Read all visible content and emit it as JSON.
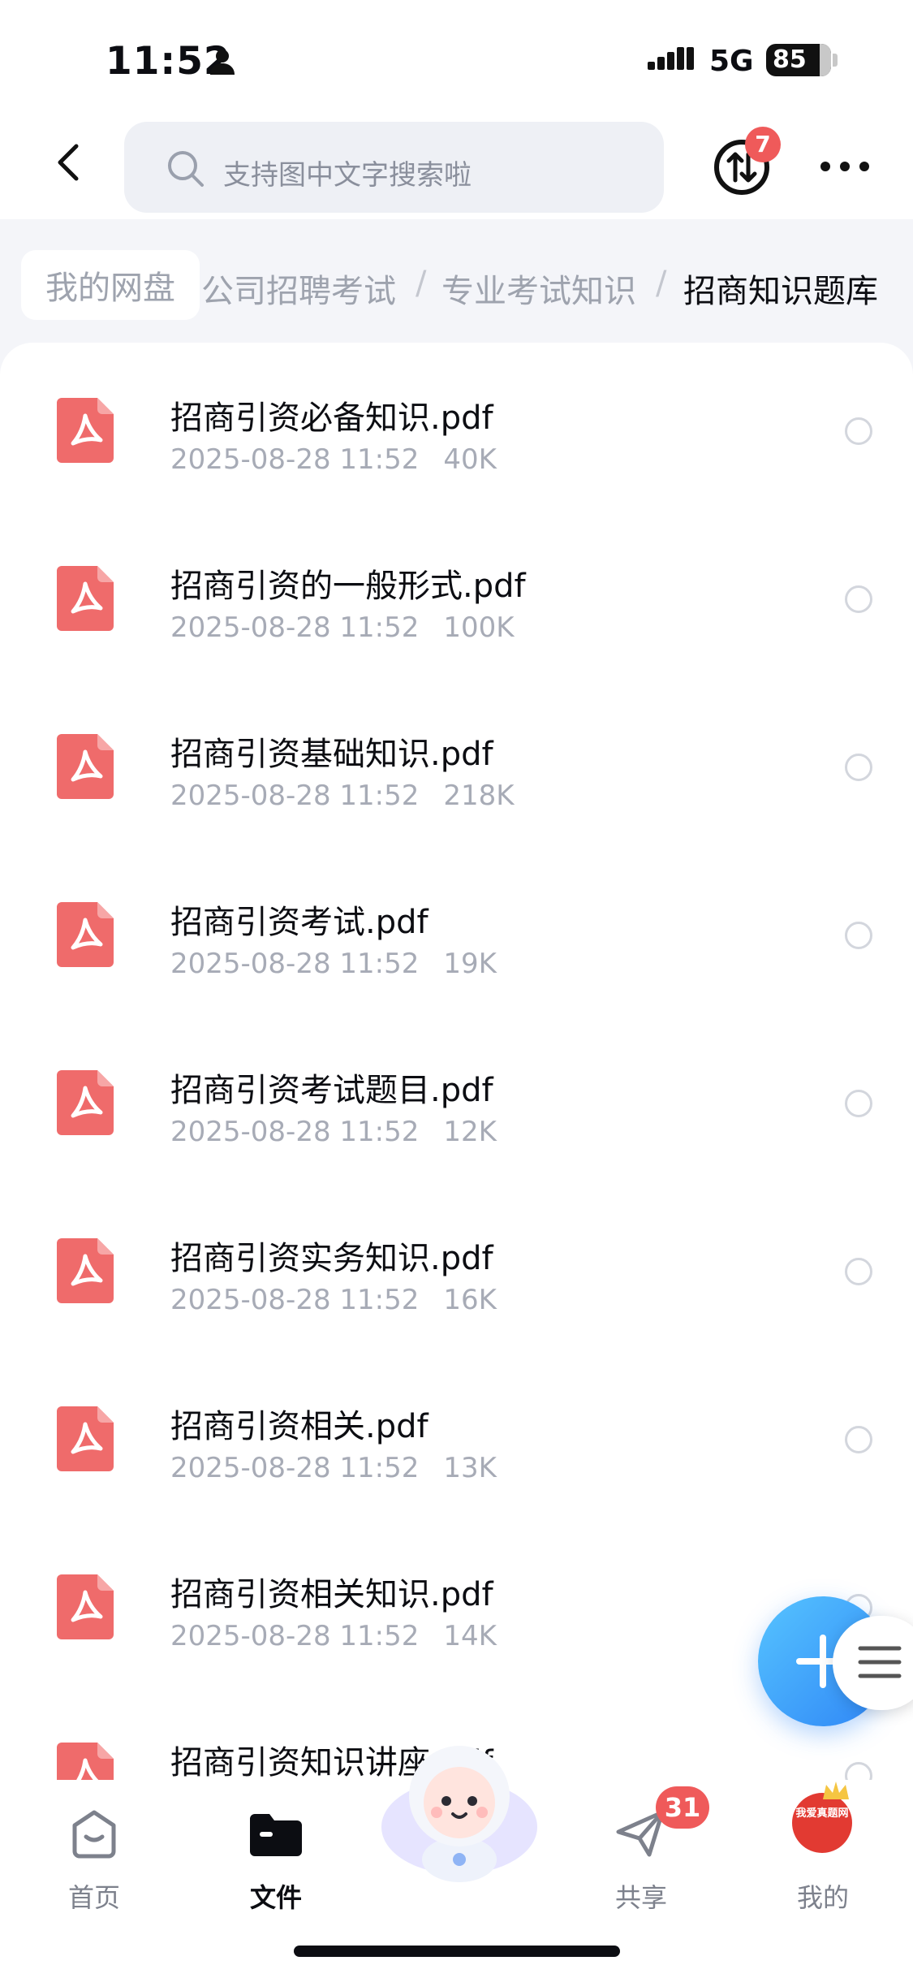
{
  "status_bar": {
    "time": "11:52",
    "network": "5G",
    "battery": "85"
  },
  "header": {
    "search_placeholder": "支持图中文字搜索啦",
    "transfer_badge": "7"
  },
  "breadcrumb": {
    "items": [
      "我的网盘",
      "公司招聘考试",
      "专业考试知识",
      "招商知识题库"
    ]
  },
  "files": [
    {
      "name": "招商引资必备知识.pdf",
      "date": "2025-08-28 11:52",
      "size": "40K"
    },
    {
      "name": "招商引资的一般形式.pdf",
      "date": "2025-08-28 11:52",
      "size": "100K"
    },
    {
      "name": "招商引资基础知识.pdf",
      "date": "2025-08-28 11:52",
      "size": "218K"
    },
    {
      "name": "招商引资考试.pdf",
      "date": "2025-08-28 11:52",
      "size": "19K"
    },
    {
      "name": "招商引资考试题目.pdf",
      "date": "2025-08-28 11:52",
      "size": "12K"
    },
    {
      "name": "招商引资实务知识.pdf",
      "date": "2025-08-28 11:52",
      "size": "16K"
    },
    {
      "name": "招商引资相关.pdf",
      "date": "2025-08-28 11:52",
      "size": "13K"
    },
    {
      "name": "招商引资相关知识.pdf",
      "date": "2025-08-28 11:52",
      "size": "14K"
    },
    {
      "name": "招商引资知识讲座.pdf",
      "date": "",
      "size": ""
    }
  ],
  "tabbar": {
    "home": "首页",
    "files": "文件",
    "share": "共享",
    "share_badge": "31",
    "mine": "我的",
    "avatar_text": "我爱真题网"
  },
  "colors": {
    "accent_blue": "#2f86f6",
    "pdf_red": "#ef6b6b",
    "badge_red": "#ef5a5a"
  }
}
